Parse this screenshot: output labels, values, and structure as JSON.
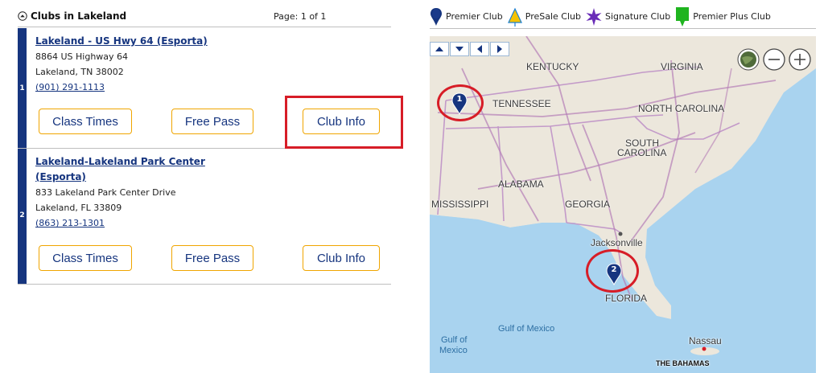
{
  "list": {
    "title": "Clubs in Lakeland",
    "page_info": "Page: 1 of 1"
  },
  "clubs": [
    {
      "index": "1",
      "name": "Lakeland - US Hwy 64 (Esporta)",
      "address1": "8864 US Highway 64",
      "address2": "Lakeland, TN  38002",
      "phone": "(901) 291-1113",
      "class_times_label": "Class Times",
      "free_pass_label": "Free Pass",
      "club_info_label": "Club Info"
    },
    {
      "index": "2",
      "name_line1": "Lakeland-Lakeland Park Center",
      "name_line2": "(Esporta)",
      "address1": "833 Lakeland Park Center Drive",
      "address2": "Lakeland, FL  33809",
      "phone": "(863) 213-1301",
      "class_times_label": "Class Times",
      "free_pass_label": "Free Pass",
      "club_info_label": "Club Info"
    }
  ],
  "legend": [
    {
      "label": "Premier Club",
      "icon": "map-pin-icon",
      "color": "#16357f"
    },
    {
      "label": "PreSale Club",
      "icon": "triangle-icon",
      "color": "#f5c200"
    },
    {
      "label": "Signature Club",
      "icon": "star-icon",
      "color": "#6a2eb8"
    },
    {
      "label": "Premier Plus Club",
      "icon": "flag-marker-icon",
      "color": "#1fb41f"
    }
  ],
  "map": {
    "labels": {
      "kentucky": "KENTUCKY",
      "virginia": "VIRGINIA",
      "tennessee": "TENNESSEE",
      "north_carolina": "NORTH CAROLINA",
      "south": "SOUTH",
      "carolina": "CAROLINA",
      "alabama": "ALABAMA",
      "mississippi": "MISSISSIPPI",
      "georgia": "GEORGIA",
      "jacksonville": "Jacksonville",
      "florida": "FLORIDA",
      "gulf_of_mexico": "Gulf of Mexico",
      "gulf_of": "Gulf of",
      "mexico": "Mexico",
      "nassau": "Nassau",
      "bahamas": "THE BAHAMAS"
    },
    "markers": [
      {
        "label": "1"
      },
      {
        "label": "2"
      }
    ]
  },
  "colors": {
    "brand_navy": "#16357f",
    "button_border": "#f0a500",
    "highlight_red": "#d71d27",
    "water": "#a9d3ef",
    "land": "#ece7dc"
  }
}
